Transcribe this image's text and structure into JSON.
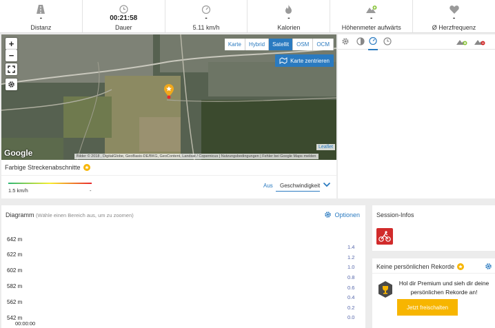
{
  "stats": [
    {
      "icon": "road-icon",
      "value": "-",
      "label": "Distanz"
    },
    {
      "icon": "clock-icon",
      "value": "00:21:58",
      "label": "Dauer"
    },
    {
      "icon": "speedometer-icon",
      "value": "-",
      "label": "5.11 km/h"
    },
    {
      "icon": "flame-icon",
      "value": "-",
      "label": "Kalorien"
    },
    {
      "icon": "mountain-up-icon",
      "value": "-",
      "label": "Höhenmeter aufwärts"
    },
    {
      "icon": "heart-icon",
      "value": "-",
      "label": "Ø Herzfrequenz"
    }
  ],
  "map": {
    "zoom_in": "+",
    "zoom_out": "−",
    "types": [
      "Karte",
      "Hybrid",
      "Satellit",
      "OSM",
      "OCM"
    ],
    "active_type": "Satellit",
    "center_label": "Karte zentrieren",
    "google": "Google",
    "attribution": "Bilder © 2018 , DigitalGlobe, GeoBasis-DE/BKG, GeoContent, Landsat / Copernicus | Nutzungsbedingungen | Fehler bei Google Maps melden",
    "leaflet": "Leaflet"
  },
  "colors": {
    "accent": "#2a7ac0",
    "premium": "#f7b500",
    "bike": "#d12b2b"
  },
  "strip": {
    "title": "Farbige Streckenabschnitte",
    "min_label": "1.5 km/h",
    "max_label": "-",
    "off_label": "Aus",
    "selected": "Geschwindigkeit"
  },
  "diagram": {
    "title": "Diagramm",
    "subtitle": "(Wähle einen Bereich aus, um zu zoomen)",
    "options": "Optionen",
    "y_left": [
      "642 m",
      "622 m",
      "602 m",
      "582 m",
      "562 m",
      "542 m"
    ],
    "y_right": [
      "1.4",
      "1.2",
      "1.0",
      "0.8",
      "0.6",
      "0.4",
      "0.2",
      "0.0"
    ],
    "x_start": "00:00:00"
  },
  "session": {
    "title": "Session-Infos"
  },
  "records": {
    "title": "Keine persönlichen Rekorde",
    "text": "Hol dir Premium und sieh dir deine persönlichen Rekorde an!",
    "button": "Jetzt freischalten"
  }
}
